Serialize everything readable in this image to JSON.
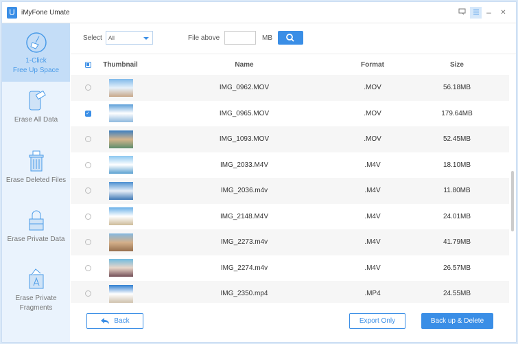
{
  "app": {
    "title": "iMyFone Umate",
    "logo_letter": "U"
  },
  "window_controls": {
    "feedback": "feedback-icon",
    "menu": "menu-icon",
    "minimize": "–",
    "close": "✕"
  },
  "sidebar": {
    "items": [
      {
        "label": "1-Click\nFree Up Space",
        "icon": "broom-icon",
        "active": true
      },
      {
        "label": "Erase All Data",
        "icon": "phone-eraser-icon"
      },
      {
        "label": "Erase Deleted Files",
        "icon": "trash-icon"
      },
      {
        "label": "Erase Private Data",
        "icon": "lock-icon"
      },
      {
        "label": "Erase Private\nFragments",
        "icon": "app-fragments-icon"
      }
    ]
  },
  "toolbar": {
    "select_label": "Select",
    "select_value": "All",
    "file_above_label": "File above",
    "file_above_value": "",
    "unit": "MB"
  },
  "table": {
    "headers": {
      "thumbnail": "Thumbnail",
      "name": "Name",
      "format": "Format",
      "size": "Size"
    },
    "rows": [
      {
        "name": "IMG_0962.MOV",
        "format": ".MOV",
        "size": "56.18MB",
        "checked": false
      },
      {
        "name": "IMG_0965.MOV",
        "format": ".MOV",
        "size": "179.64MB",
        "checked": true
      },
      {
        "name": "IMG_1093.MOV",
        "format": ".MOV",
        "size": "52.45MB",
        "checked": false
      },
      {
        "name": "IMG_2033.M4V",
        "format": ".M4V",
        "size": "18.10MB",
        "checked": false
      },
      {
        "name": "IMG_2036.m4v",
        "format": ".M4V",
        "size": "11.80MB",
        "checked": false
      },
      {
        "name": "IMG_2148.M4V",
        "format": ".M4V",
        "size": "24.01MB",
        "checked": false
      },
      {
        "name": "IMG_2273.m4v",
        "format": ".M4V",
        "size": "41.79MB",
        "checked": false
      },
      {
        "name": "IMG_2274.m4v",
        "format": ".M4V",
        "size": "26.57MB",
        "checked": false
      },
      {
        "name": "IMG_2350.mp4",
        "format": ".MP4",
        "size": "24.55MB",
        "checked": false
      }
    ]
  },
  "footer": {
    "back": "Back",
    "export": "Export Only",
    "backup_delete": "Back up & Delete"
  },
  "colors": {
    "accent": "#3a8ee6",
    "sidebar_bg": "#eaf3fd",
    "sidebar_active": "#c4ddf7"
  }
}
